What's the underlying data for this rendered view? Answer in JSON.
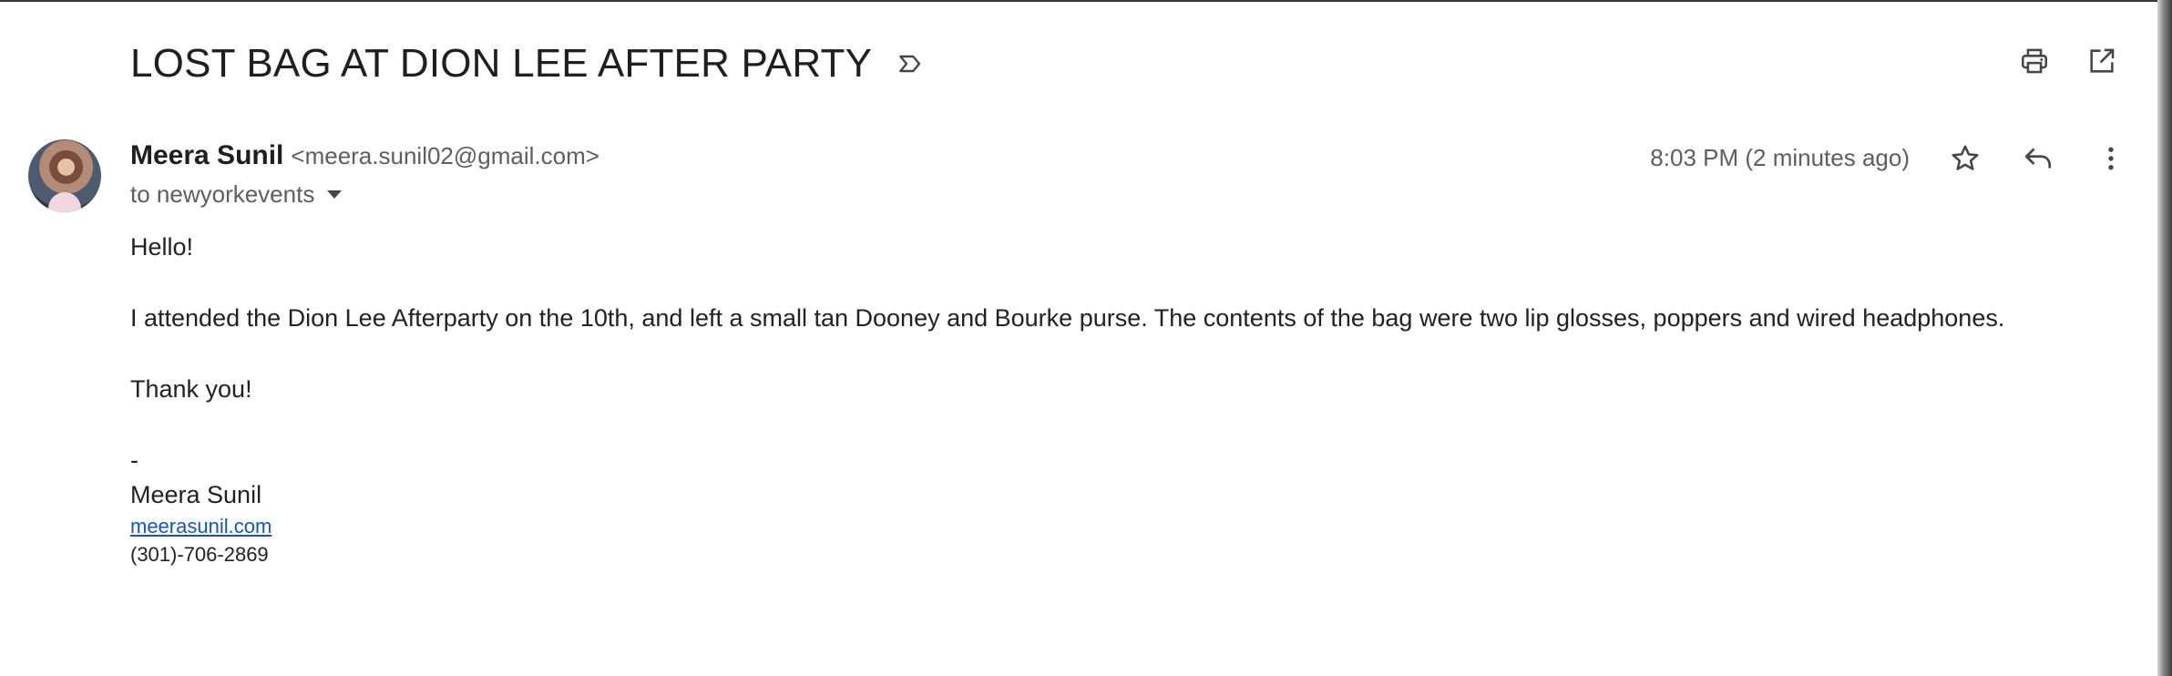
{
  "email": {
    "subject": "LOST BAG AT DION LEE AFTER PARTY",
    "sender": {
      "name": "Meera Sunil",
      "email": "<meera.sunil02@gmail.com>"
    },
    "recipient_line": "to newyorkevents",
    "timestamp": "8:03 PM (2 minutes ago)",
    "body": {
      "greeting": "Hello!",
      "paragraph": "I attended the Dion Lee Afterparty on the 10th, and left a small tan Dooney and Bourke purse. The contents of the bag were two lip glosses, poppers and wired headphones.",
      "closing": "Thank you!"
    },
    "signature": {
      "dash": "-",
      "name": "Meera Sunil",
      "website": "meerasunil.com",
      "phone": "(301)-706-2869"
    }
  },
  "icons": {
    "label": "label-important-icon",
    "print": "print-icon",
    "open_new_window": "open-in-new-icon",
    "star": "star-icon",
    "reply": "reply-icon",
    "more": "more-vert-icon",
    "recipient_details": "chevron-down-icon"
  },
  "colors": {
    "text_primary": "#1f1f1f",
    "text_secondary": "#5e5e5e",
    "link": "#1155cc",
    "icon": "#444746"
  }
}
